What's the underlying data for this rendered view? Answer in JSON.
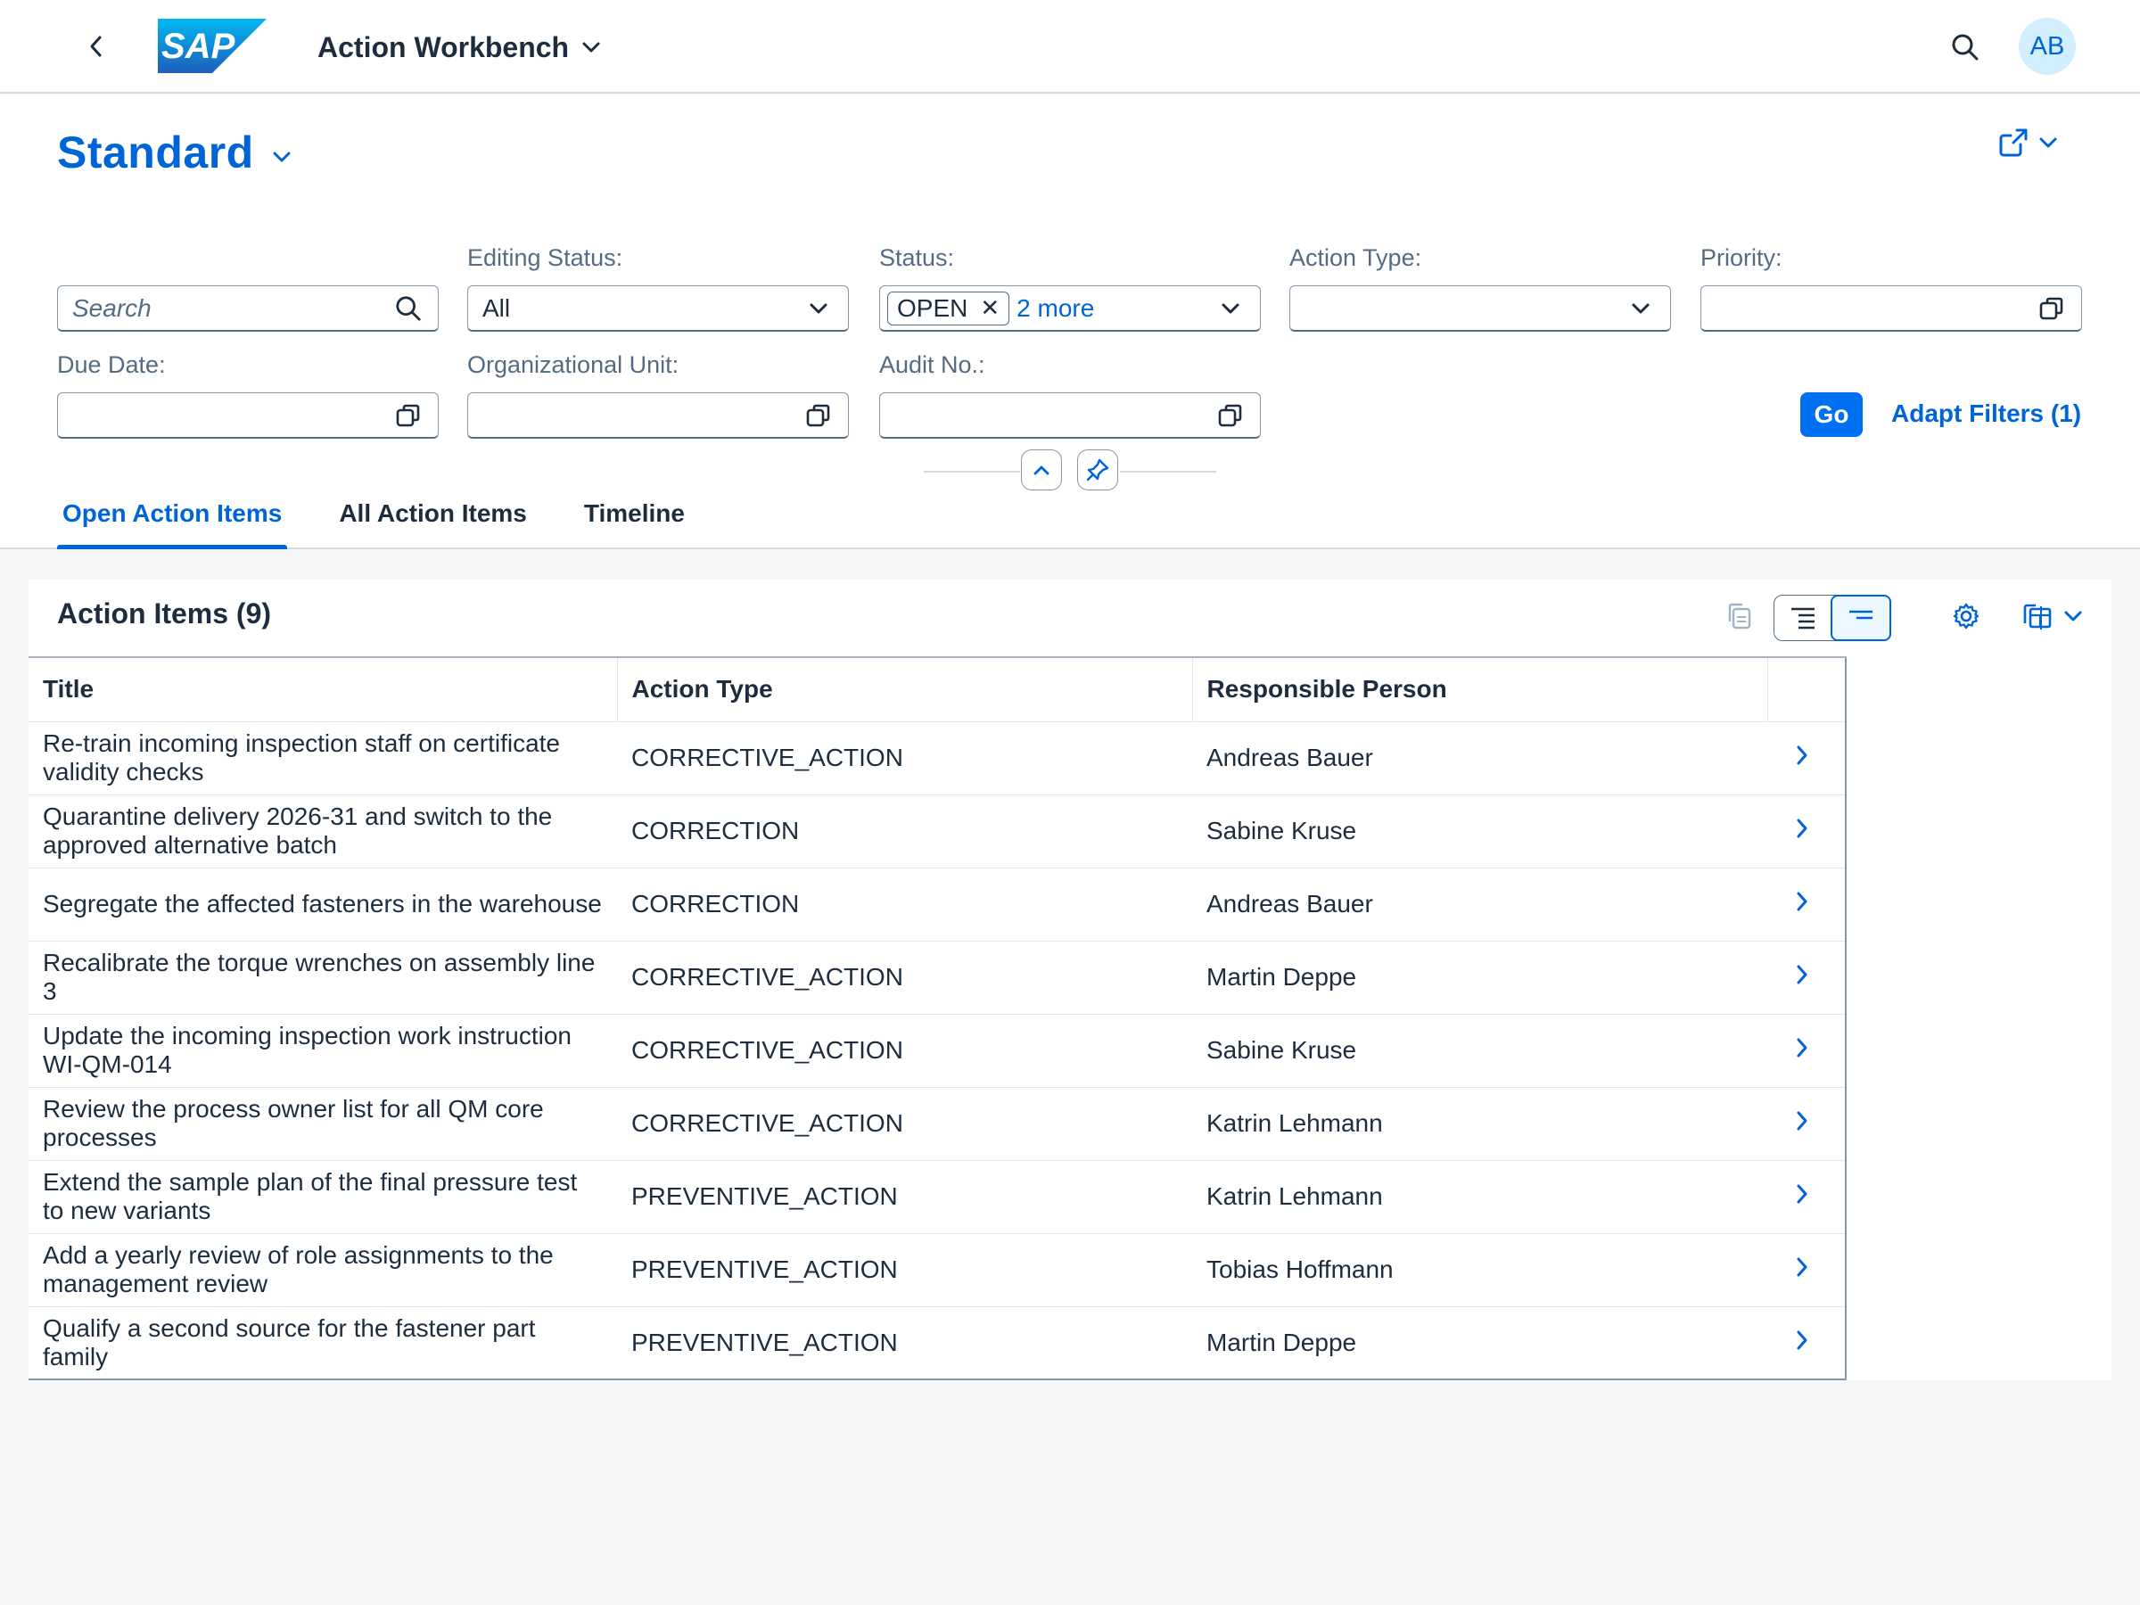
{
  "shell": {
    "app_title": "Action Workbench",
    "avatar_initials": "AB",
    "brand_color": "#0070f2"
  },
  "header": {
    "variant_name": "Standard"
  },
  "filters": {
    "search_placeholder": "Search",
    "editing_status": {
      "label": "Editing Status:",
      "value": "All"
    },
    "status": {
      "label": "Status:",
      "token": "OPEN",
      "more": "2 more"
    },
    "action_type": {
      "label": "Action Type:",
      "value": ""
    },
    "priority": {
      "label": "Priority:",
      "value": ""
    },
    "due_date": {
      "label": "Due Date:",
      "value": ""
    },
    "org_unit": {
      "label": "Organizational Unit:",
      "value": ""
    },
    "audit_no": {
      "label": "Audit No.:",
      "value": ""
    },
    "go_label": "Go",
    "adapt_label": "Adapt Filters (1)"
  },
  "tabs": [
    {
      "label": "Open Action Items",
      "active": true
    },
    {
      "label": "All Action Items",
      "active": false
    },
    {
      "label": "Timeline",
      "active": false
    }
  ],
  "table": {
    "title": "Action Items (9)",
    "columns": [
      "Title",
      "Action Type",
      "Responsible Person"
    ],
    "rows": [
      {
        "title": "Re-train incoming inspection staff on certificate validity checks",
        "type": "CORRECTIVE_ACTION",
        "person": "Andreas Bauer"
      },
      {
        "title": "Quarantine delivery 2026-31 and switch to the approved alternative batch",
        "type": "CORRECTION",
        "person": "Sabine Kruse"
      },
      {
        "title": "Segregate the affected fasteners in the warehouse",
        "type": "CORRECTION",
        "person": "Andreas Bauer"
      },
      {
        "title": "Recalibrate the torque wrenches on assembly line 3",
        "type": "CORRECTIVE_ACTION",
        "person": "Martin Deppe"
      },
      {
        "title": "Update the incoming inspection work instruction WI-QM-014",
        "type": "CORRECTIVE_ACTION",
        "person": "Sabine Kruse"
      },
      {
        "title": "Review the process owner list for all QM core processes",
        "type": "CORRECTIVE_ACTION",
        "person": "Katrin Lehmann"
      },
      {
        "title": "Extend the sample plan of the final pressure test to new variants",
        "type": "PREVENTIVE_ACTION",
        "person": "Katrin Lehmann"
      },
      {
        "title": "Add a yearly review of role assignments to the management review",
        "type": "PREVENTIVE_ACTION",
        "person": "Tobias Hoffmann"
      },
      {
        "title": "Qualify a second source for the fastener part family",
        "type": "PREVENTIVE_ACTION",
        "person": "Martin Deppe"
      }
    ]
  },
  "icons": {
    "back": "chevron-left-icon",
    "search": "search-icon",
    "value_help": "value-help-icon",
    "share": "share-icon",
    "settings": "gear-icon",
    "export": "export-icon",
    "row_nav": "chevron-right-icon"
  }
}
